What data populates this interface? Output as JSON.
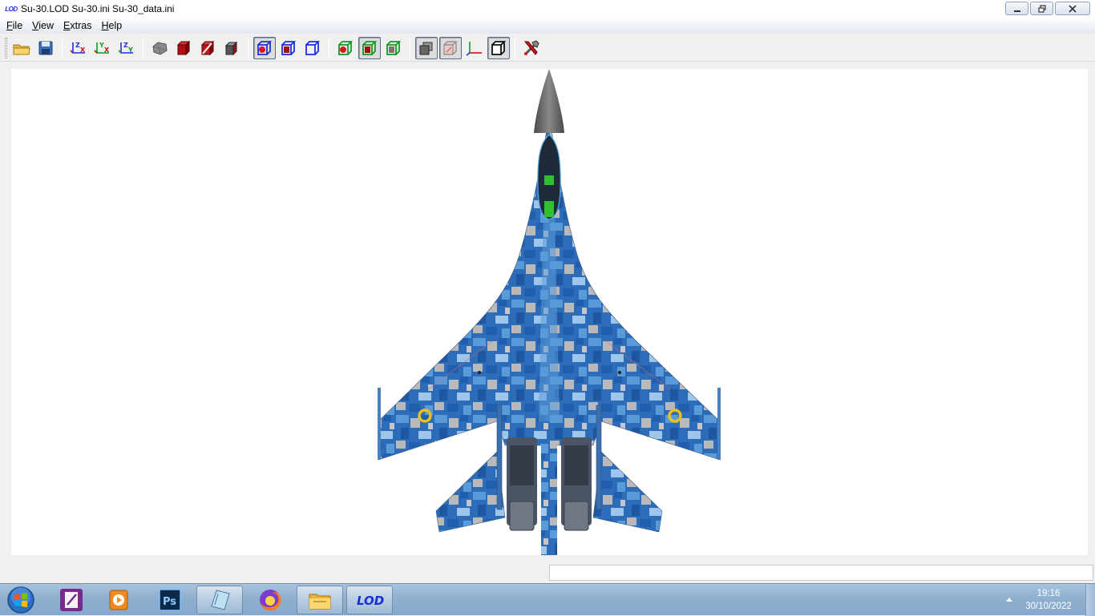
{
  "window": {
    "logo_text": "LOD",
    "title": "Su-30.LOD  Su-30.ini  Su-30_data.ini",
    "buttons": [
      "minimize-icon",
      "restore-icon",
      "close-icon"
    ]
  },
  "menu": {
    "items": [
      {
        "label": "File",
        "key": "F",
        "rest": "ile"
      },
      {
        "label": "View",
        "key": "V",
        "rest": "iew"
      },
      {
        "label": "Extras",
        "key": "E",
        "rest": "xtras"
      },
      {
        "label": "Help",
        "key": "H",
        "rest": "elp"
      }
    ]
  },
  "toolbar": {
    "groups": [
      [
        "open-folder-icon",
        "save-disk-icon"
      ],
      [
        "axis-zx-icon",
        "axis-yx-icon",
        "axis-zy-icon"
      ],
      [
        "gray-mesh-icon",
        "red-solid-cube-icon",
        "red-lod-cube-icon",
        "shaded-cube-icon"
      ],
      [
        "blue-wire-cube-pressed-icon",
        "blue-solid-wire-cube-icon",
        "blue-wire-cube-icon"
      ],
      [
        "green-lod-cube-icon",
        "green-red-cube-pressed-icon",
        "green-gray-cube-icon"
      ],
      [
        "gray-stack-cube-pressed-icon",
        "transparent-cube-pressed-icon",
        "axes-corner-icon",
        "outline-cube-pressed-icon"
      ],
      [
        "tools-icon"
      ]
    ],
    "accent_colors": {
      "red": "#cc1111",
      "blue": "#1e2fd8",
      "green": "#119922"
    }
  },
  "viewport": {
    "model": "Su-30",
    "camouflage_colors": [
      "#1f5fae",
      "#5a9ad8",
      "#b9b9bb",
      "#9ec6ea"
    ],
    "roundel_color": "#e7c21a"
  },
  "status": {
    "text": ""
  },
  "taskbar": {
    "apps": [
      {
        "name": "vlc-app",
        "icon": "notepad-icon"
      },
      {
        "name": "media-app",
        "icon": "media-player-icon"
      },
      {
        "name": "photoshop-app",
        "icon": "photoshop-icon",
        "label": "Ps"
      },
      {
        "name": "notepad-app",
        "icon": "notebook-icon"
      },
      {
        "name": "firefox-app",
        "icon": "firefox-icon"
      },
      {
        "name": "explorer-app",
        "icon": "folder-icon"
      },
      {
        "name": "lod-app",
        "icon": "lod-icon",
        "label": "LOD"
      }
    ],
    "clock_time": "19:16",
    "clock_date": "30/10/2022"
  }
}
